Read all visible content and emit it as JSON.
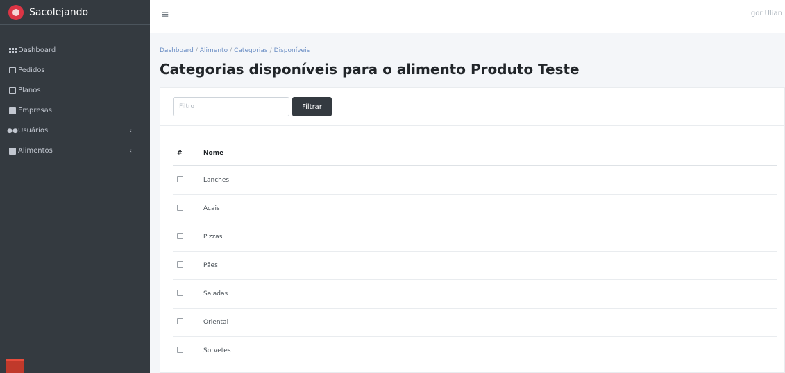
{
  "brand": {
    "name": "Sacolejando"
  },
  "sidebar": {
    "items": [
      {
        "label": "Dashboard",
        "icon": "grid-icon"
      },
      {
        "label": "Pedidos",
        "icon": "box-icon"
      },
      {
        "label": "Planos",
        "icon": "box-icon"
      },
      {
        "label": "Empresas",
        "icon": "building-icon"
      },
      {
        "label": "Usuários",
        "icon": "users-icon",
        "has_children": true
      },
      {
        "label": "Alimentos",
        "icon": "food-icon",
        "has_children": true
      }
    ]
  },
  "topbar": {
    "user": "Igor Ulian",
    "menu_icon": "hamburger-icon"
  },
  "breadcrumb": [
    "Dashboard",
    "Alimento",
    "Categorias",
    "Disponíveis"
  ],
  "page": {
    "title_prefix": "Categorias disponíveis para o alimento ",
    "title_product": "Produto Teste"
  },
  "filter": {
    "placeholder": "Filtro",
    "button_label": "Filtrar"
  },
  "table": {
    "headers": {
      "index": "#",
      "name": "Nome"
    },
    "rows": [
      "Lanches",
      "Açais",
      "Pizzas",
      "Pães",
      "Saladas",
      "Oriental",
      "Sorvetes"
    ]
  },
  "colors": {
    "sidebar": "#343a40",
    "accent": "#dc3545",
    "button": "#343a40"
  }
}
